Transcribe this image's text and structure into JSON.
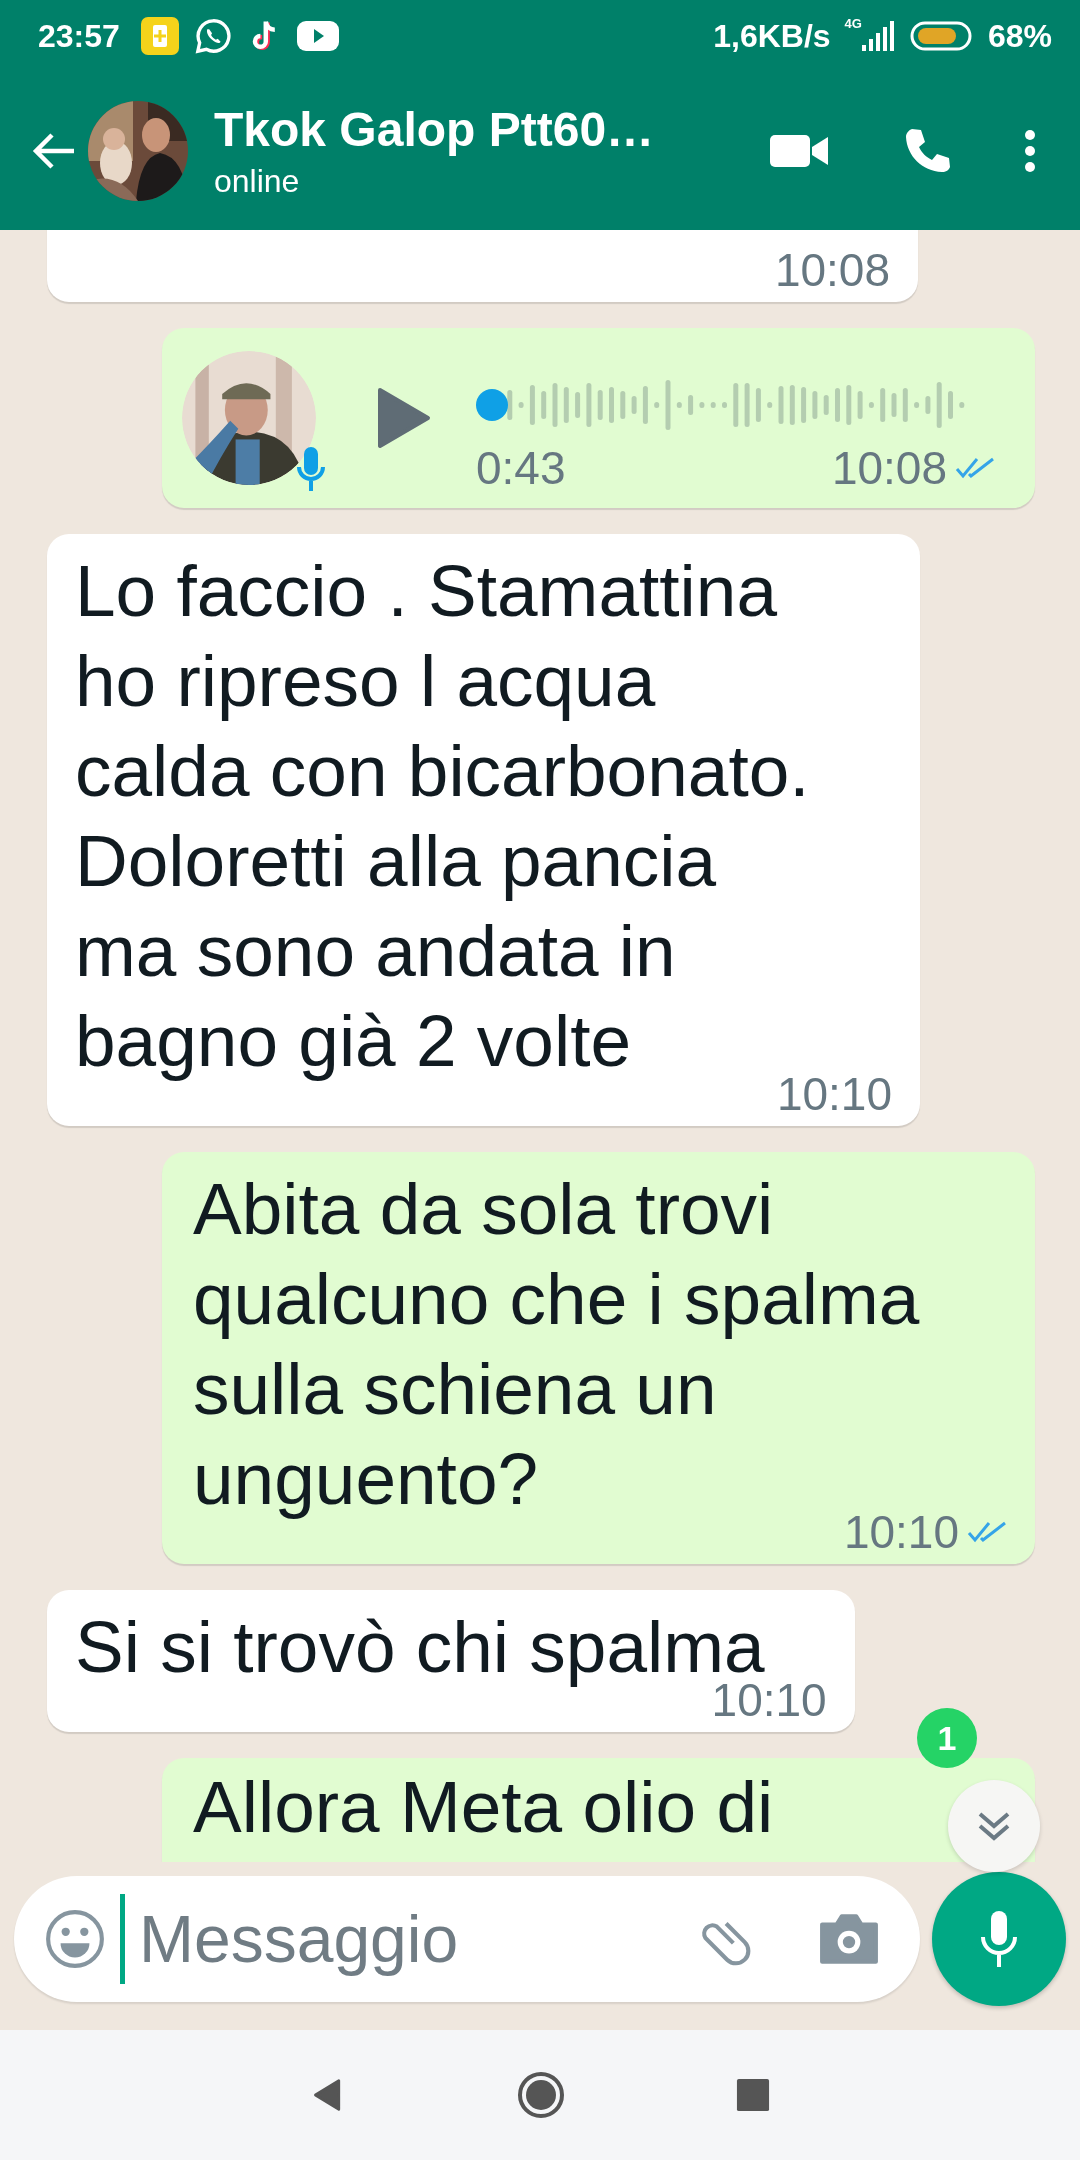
{
  "status_bar": {
    "time": "23:57",
    "speed": "1,6KB/s",
    "network": "4G",
    "battery": "68%"
  },
  "header": {
    "title": "Tkok Galop Ptt60…",
    "subtitle": "online"
  },
  "messages": [
    {
      "kind": "text",
      "outgoing": false,
      "time": "10:08"
    },
    {
      "kind": "voice",
      "outgoing": true,
      "duration": "0:43",
      "time": "10:08",
      "read": true
    },
    {
      "kind": "text",
      "outgoing": false,
      "text": "Lo faccio . Stamattina ho ripreso l acqua calda con bicarbonato. Doloretti alla pancia ma sono andata in bagno già 2 volte",
      "time": "10:10"
    },
    {
      "kind": "text",
      "outgoing": true,
      "text": "Abita da sola trovi qualcuno che i spalma sulla schiena un unguento?",
      "time": "10:10",
      "read": true
    },
    {
      "kind": "text",
      "outgoing": false,
      "text": "Si si trovò chi spalma",
      "time": "10:10"
    },
    {
      "kind": "text",
      "outgoing": true,
      "text": "Allora Meta olio di"
    }
  ],
  "unread_count": "1",
  "composer": {
    "placeholder": "Messaggio"
  }
}
